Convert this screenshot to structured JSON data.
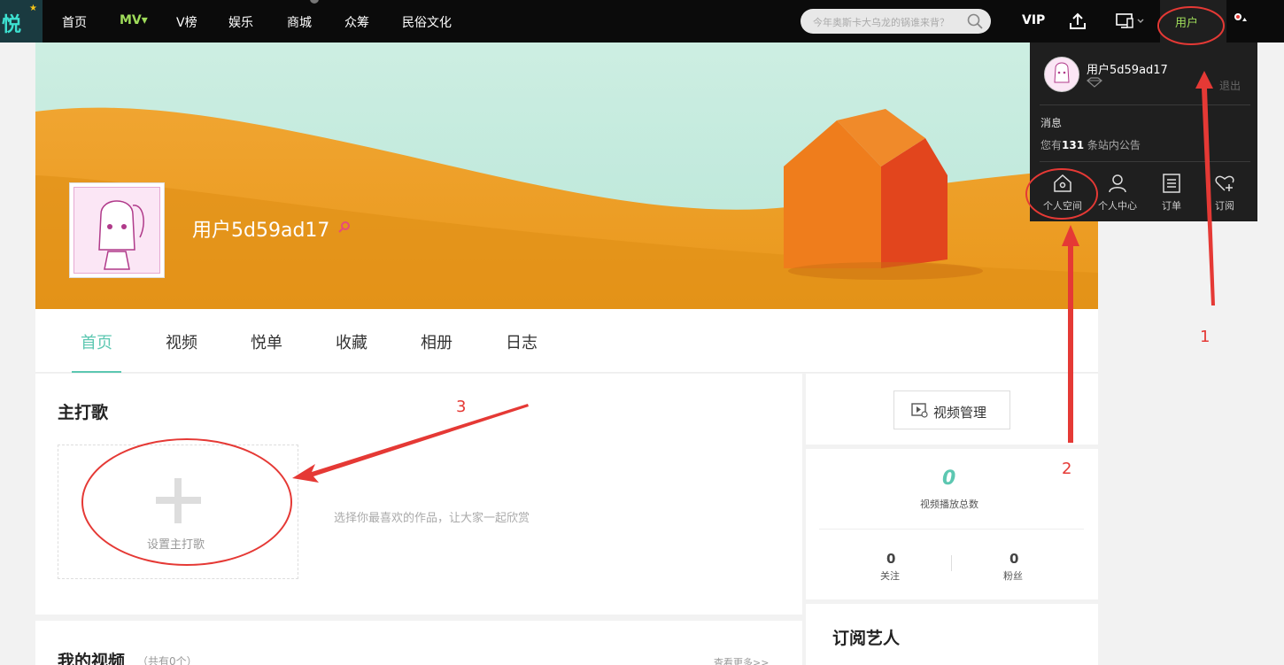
{
  "brand": {
    "logo_text": "悦",
    "star": "★"
  },
  "nav": {
    "items": [
      "首页",
      "MV",
      "V榜",
      "娱乐",
      "商城",
      "众筹",
      "民俗文化"
    ],
    "mv_caret": "▾"
  },
  "search": {
    "placeholder": "今年奥斯卡大乌龙的锅谁来背？"
  },
  "header": {
    "vip": "VIP",
    "user": "用户"
  },
  "profile": {
    "username": "用户5d59ad17"
  },
  "tabs": [
    "首页",
    "视频",
    "悦单",
    "收藏",
    "相册",
    "日志"
  ],
  "main_song": {
    "title": "主打歌",
    "add_label": "设置主打歌",
    "hint": "选择你最喜欢的作品，让大家一起欣赏"
  },
  "my_videos": {
    "title": "我的视频",
    "count": "（共有0个）",
    "more": "查看更多>>"
  },
  "sidebar": {
    "video_manage": "视频管理",
    "play_total": "0",
    "play_total_label": "视频播放总数",
    "follow_count": "0",
    "follow_label": "关注",
    "fans_count": "0",
    "fans_label": "粉丝",
    "subscribed_title": "订阅艺人"
  },
  "dropdown": {
    "username": "用户5d59ad17",
    "logout": "退出",
    "messages_title": "消息",
    "notice_prefix": "您有",
    "notice_count": "131",
    "notice_suffix": " 条站内公告",
    "actions": [
      "个人空间",
      "个人中心",
      "订单",
      "订阅"
    ]
  },
  "annotations": [
    "1",
    "2",
    "3"
  ],
  "colors": {
    "accent": "#5cc7b1",
    "nav_active": "#9fdc5a",
    "annotation": "#e53935"
  }
}
